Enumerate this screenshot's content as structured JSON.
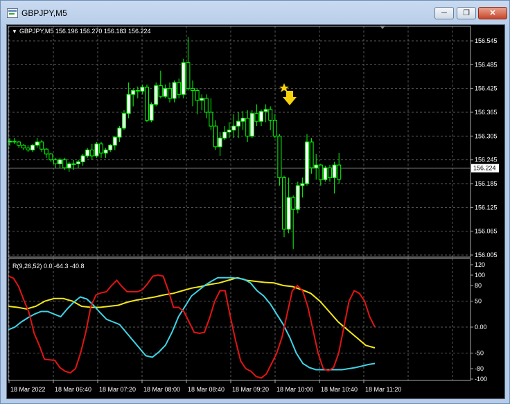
{
  "window": {
    "title": "GBPJPY,M5",
    "minimize_icon": "minimize-icon",
    "restore_icon": "restore-icon",
    "close_icon": "close-icon",
    "app_icon": "chart-window-icon"
  },
  "colors": {
    "background": "#000000",
    "grid": "#5a5a5a",
    "bull": "#00ff00",
    "candle_body_up": "#ffffff",
    "candle_body_down": "#000000",
    "red_line": "#e31414",
    "cyan_line": "#3fd4e6",
    "yellow_line": "#f2e61a",
    "signal_arrow": "#f5d20a"
  },
  "chart_header": {
    "label": "GBPJPY,M5 156.196 156.270 156.183 156.224"
  },
  "price_axis": {
    "ticks": [
      "156.545",
      "156.485",
      "156.425",
      "156.365",
      "156.305",
      "156.245",
      "156.185",
      "156.125",
      "156.065",
      "156.005"
    ],
    "current_price": "156.224"
  },
  "indicator": {
    "label": "R(9,26,52) 0.0 -64.3 -40.8",
    "ticks": [
      "120",
      "100",
      "80",
      "50",
      "0.00",
      "-50",
      "-80",
      "-100"
    ]
  },
  "time_axis": {
    "labels": [
      "18 Mar 2022",
      "18 Mar 06:40",
      "18 Mar 07:20",
      "18 Mar 08:00",
      "18 Mar 08:40",
      "18 Mar 09:20",
      "18 Mar 10:00",
      "18 Mar 10:40",
      "18 Mar 11:20"
    ]
  },
  "candles_ohlc": [
    [
      156.29,
      156.3,
      156.28,
      156.292
    ],
    [
      156.292,
      156.3,
      156.285,
      156.29
    ],
    [
      156.29,
      156.293,
      156.275,
      156.282
    ],
    [
      156.282,
      156.285,
      156.27,
      156.275
    ],
    [
      156.275,
      156.282,
      156.265,
      156.27
    ],
    [
      156.27,
      156.285,
      156.265,
      156.282
    ],
    [
      156.282,
      156.3,
      156.275,
      156.29
    ],
    [
      156.29,
      156.295,
      156.265,
      156.272
    ],
    [
      156.272,
      156.275,
      156.25,
      156.26
    ],
    [
      156.26,
      156.262,
      156.24,
      156.245
    ],
    [
      156.245,
      156.25,
      156.225,
      156.235
    ],
    [
      156.235,
      156.25,
      156.225,
      156.245
    ],
    [
      156.245,
      156.25,
      156.22,
      156.225
    ],
    [
      156.225,
      156.24,
      156.215,
      156.235
    ],
    [
      156.235,
      156.245,
      156.22,
      156.235
    ],
    [
      156.235,
      156.245,
      156.225,
      156.24
    ],
    [
      156.24,
      156.26,
      156.23,
      156.255
    ],
    [
      156.255,
      156.275,
      156.25,
      156.27
    ],
    [
      156.27,
      156.285,
      156.245,
      156.255
    ],
    [
      156.255,
      156.29,
      156.25,
      156.285
    ],
    [
      156.285,
      156.29,
      156.25,
      156.262
    ],
    [
      156.262,
      156.275,
      156.25,
      156.27
    ],
    [
      156.27,
      156.285,
      156.265,
      156.282
    ],
    [
      156.282,
      156.305,
      156.27,
      156.302
    ],
    [
      156.302,
      156.33,
      156.29,
      156.325
    ],
    [
      156.325,
      156.37,
      156.32,
      156.362
    ],
    [
      156.362,
      156.44,
      156.35,
      156.41
    ],
    [
      156.41,
      156.425,
      156.38,
      156.42
    ],
    [
      156.42,
      156.43,
      156.4,
      156.418
    ],
    [
      156.418,
      156.435,
      156.41,
      156.428
    ],
    [
      156.428,
      156.435,
      156.34,
      156.345
    ],
    [
      156.345,
      156.39,
      156.34,
      156.385
    ],
    [
      156.385,
      156.44,
      156.38,
      156.432
    ],
    [
      156.432,
      156.47,
      156.4,
      156.405
    ],
    [
      156.405,
      156.435,
      156.4,
      156.425
    ],
    [
      156.425,
      156.44,
      156.39,
      156.4
    ],
    [
      156.4,
      156.445,
      156.39,
      156.44
    ],
    [
      156.44,
      156.45,
      156.4,
      156.41
    ],
    [
      156.41,
      156.5,
      156.4,
      156.49
    ],
    [
      156.49,
      156.555,
      156.42,
      156.425
    ],
    [
      156.425,
      156.445,
      156.38,
      156.42
    ],
    [
      156.42,
      156.425,
      156.36,
      156.395
    ],
    [
      156.395,
      156.41,
      156.37,
      156.4
    ],
    [
      156.4,
      156.41,
      156.35,
      156.365
    ],
    [
      156.365,
      156.4,
      156.32,
      156.33
    ],
    [
      156.33,
      156.345,
      156.27,
      156.278
    ],
    [
      156.278,
      156.315,
      156.255,
      156.3
    ],
    [
      156.3,
      156.33,
      156.295,
      156.315
    ],
    [
      156.315,
      156.34,
      156.3,
      156.32
    ],
    [
      156.32,
      156.36,
      156.3,
      156.33
    ],
    [
      156.33,
      156.365,
      156.3,
      156.342
    ],
    [
      156.342,
      156.368,
      156.32,
      156.35
    ],
    [
      156.35,
      156.37,
      156.29,
      156.305
    ],
    [
      156.305,
      156.37,
      156.3,
      156.362
    ],
    [
      156.362,
      156.385,
      156.33,
      156.342
    ],
    [
      156.342,
      156.372,
      156.33,
      156.367
    ],
    [
      156.367,
      156.385,
      156.34,
      156.372
    ],
    [
      156.372,
      156.38,
      156.32,
      156.345
    ],
    [
      156.345,
      156.36,
      156.3,
      156.305
    ],
    [
      156.305,
      156.31,
      156.18,
      156.2
    ],
    [
      156.2,
      156.205,
      156.05,
      156.07
    ],
    [
      156.07,
      156.2,
      156.06,
      156.15
    ],
    [
      156.15,
      156.155,
      156.02,
      156.12
    ],
    [
      156.12,
      156.19,
      156.11,
      156.18
    ],
    [
      156.18,
      156.2,
      156.15,
      156.185
    ],
    [
      156.185,
      156.31,
      156.18,
      156.29
    ],
    [
      156.29,
      156.3,
      156.21,
      156.225
    ],
    [
      156.225,
      156.26,
      156.195,
      156.232
    ],
    [
      156.232,
      156.235,
      156.18,
      156.195
    ],
    [
      156.195,
      156.23,
      156.19,
      156.225
    ],
    [
      156.225,
      156.232,
      156.19,
      156.2
    ],
    [
      156.2,
      156.24,
      156.16,
      156.232
    ],
    [
      156.232,
      156.262,
      156.185,
      156.196
    ]
  ],
  "indicator_series": {
    "red": [
      98,
      94,
      78,
      52,
      28,
      -12,
      -35,
      -62,
      -63,
      -64,
      -78,
      -85,
      -88,
      -80,
      -50,
      -10,
      40,
      62,
      66,
      68,
      80,
      90,
      78,
      68,
      68,
      68,
      72,
      84,
      98,
      100,
      98,
      70,
      38,
      38,
      30,
      10,
      -10,
      -12,
      -10,
      18,
      50,
      70,
      70,
      20,
      -25,
      -65,
      -80,
      -85,
      -95,
      -98,
      -90,
      -70,
      -50,
      -20,
      25,
      70,
      80,
      70,
      40,
      -5,
      -50,
      -80,
      -84,
      -78,
      -50,
      0,
      50,
      70,
      65,
      50,
      20,
      0
    ],
    "cyan": [
      -5,
      0,
      10,
      18,
      25,
      30,
      30,
      25,
      20,
      35,
      48,
      58,
      54,
      42,
      28,
      15,
      10,
      5,
      -10,
      -25,
      -40,
      -55,
      -58,
      -48,
      -35,
      -10,
      20,
      40,
      60,
      70,
      80,
      88,
      95,
      95,
      95,
      94,
      92,
      85,
      70,
      60,
      45,
      25,
      5,
      -20,
      -50,
      -70,
      -78,
      -82,
      -82,
      -82,
      -82,
      -82,
      -80,
      -78,
      -75,
      -72,
      -70
    ],
    "yellow": [
      40,
      38,
      35,
      40,
      50,
      55,
      55,
      50,
      40,
      38,
      38,
      40,
      42,
      48,
      52,
      55,
      58,
      62,
      65,
      70,
      75,
      78,
      82,
      85,
      90,
      95,
      90,
      88,
      86,
      85,
      80,
      78,
      72,
      65,
      50,
      30,
      10,
      -5,
      -20,
      -35,
      -40
    ]
  }
}
